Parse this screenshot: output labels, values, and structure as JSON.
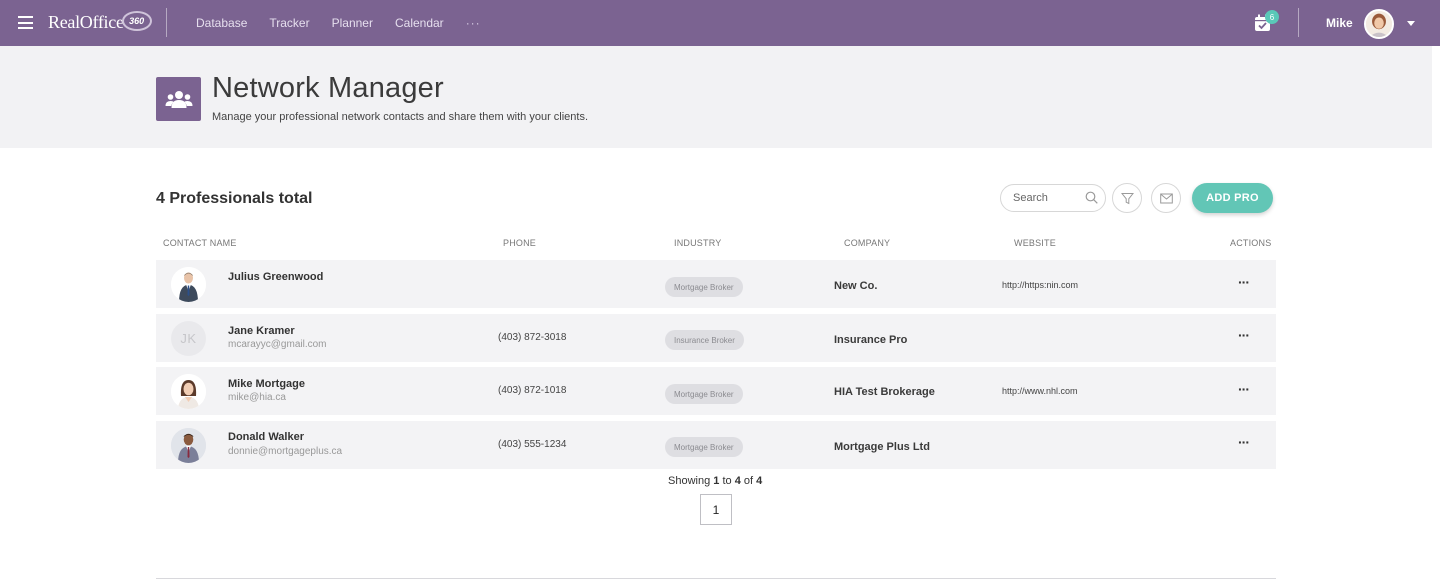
{
  "topbar": {
    "logo_text": "RealOffice",
    "logo_badge": "360",
    "nav": [
      "Database",
      "Tracker",
      "Planner",
      "Calendar"
    ],
    "nav_more": "···",
    "notifications_count": "6",
    "user_name": "Mike"
  },
  "header": {
    "title": "Network Manager",
    "subtitle": "Manage your professional network contacts and share them with your clients."
  },
  "toolbar": {
    "total_label": "4 Professionals total",
    "search_placeholder": "Search",
    "add_button": "ADD PRO"
  },
  "table": {
    "columns": [
      "CONTACT NAME",
      "PHONE",
      "INDUSTRY",
      "COMPANY",
      "WEBSITE",
      "ACTIONS"
    ],
    "rows": [
      {
        "name": "Julius Greenwood",
        "email": "",
        "phone": "",
        "industry": "Mortgage Broker",
        "company": "New Co.",
        "website": "http://https:nin.com",
        "avatar": "photo-man-suit",
        "initials": ""
      },
      {
        "name": "Jane Kramer",
        "email": "mcarayyc@gmail.com",
        "phone": "(403) 872-3018",
        "industry": "Insurance Broker",
        "company": "Insurance Pro",
        "website": "",
        "avatar": "initials",
        "initials": "JK"
      },
      {
        "name": "Mike Mortgage",
        "email": "mike@hia.ca",
        "phone": "(403) 872-1018",
        "industry": "Mortgage Broker",
        "company": "HIA Test Brokerage",
        "website": "http://www.nhl.com",
        "avatar": "photo-woman",
        "initials": ""
      },
      {
        "name": "Donald Walker",
        "email": "donnie@mortgageplus.ca",
        "phone": "(403) 555-1234",
        "industry": "Mortgage Broker",
        "company": "Mortgage Plus Ltd",
        "website": "",
        "avatar": "photo-man-tie",
        "initials": ""
      }
    ],
    "actions_label": "···"
  },
  "pagination": {
    "showing_prefix": "Showing",
    "from": "1",
    "to_word": "to",
    "to": "4",
    "of_word": "of",
    "total": "4",
    "current_page": "1"
  },
  "colors": {
    "brand": "#7b6391",
    "accent": "#62c6b6"
  }
}
